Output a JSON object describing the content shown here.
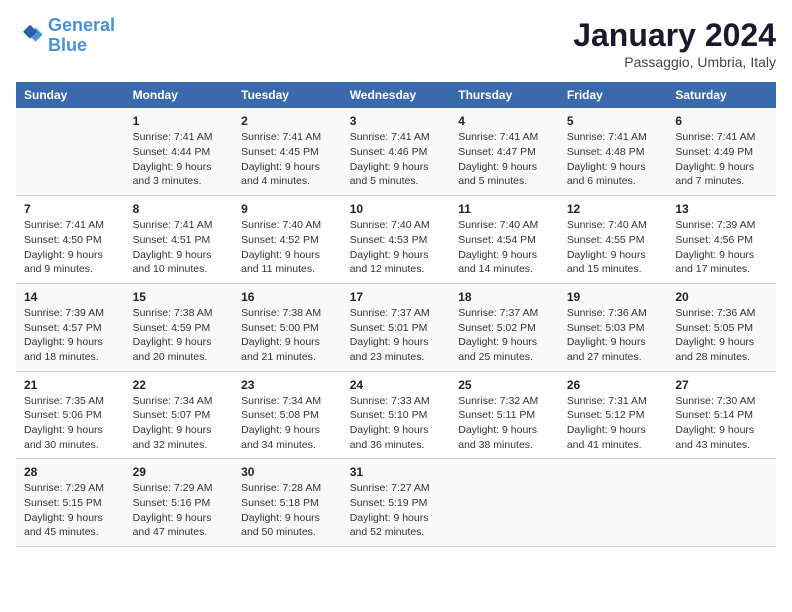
{
  "logo": {
    "line1": "General",
    "line2": "Blue"
  },
  "title": "January 2024",
  "subtitle": "Passaggio, Umbria, Italy",
  "columns": [
    "Sunday",
    "Monday",
    "Tuesday",
    "Wednesday",
    "Thursday",
    "Friday",
    "Saturday"
  ],
  "weeks": [
    [
      {
        "day": "",
        "info": ""
      },
      {
        "day": "1",
        "info": "Sunrise: 7:41 AM\nSunset: 4:44 PM\nDaylight: 9 hours\nand 3 minutes."
      },
      {
        "day": "2",
        "info": "Sunrise: 7:41 AM\nSunset: 4:45 PM\nDaylight: 9 hours\nand 4 minutes."
      },
      {
        "day": "3",
        "info": "Sunrise: 7:41 AM\nSunset: 4:46 PM\nDaylight: 9 hours\nand 5 minutes."
      },
      {
        "day": "4",
        "info": "Sunrise: 7:41 AM\nSunset: 4:47 PM\nDaylight: 9 hours\nand 5 minutes."
      },
      {
        "day": "5",
        "info": "Sunrise: 7:41 AM\nSunset: 4:48 PM\nDaylight: 9 hours\nand 6 minutes."
      },
      {
        "day": "6",
        "info": "Sunrise: 7:41 AM\nSunset: 4:49 PM\nDaylight: 9 hours\nand 7 minutes."
      }
    ],
    [
      {
        "day": "7",
        "info": "Sunrise: 7:41 AM\nSunset: 4:50 PM\nDaylight: 9 hours\nand 9 minutes."
      },
      {
        "day": "8",
        "info": "Sunrise: 7:41 AM\nSunset: 4:51 PM\nDaylight: 9 hours\nand 10 minutes."
      },
      {
        "day": "9",
        "info": "Sunrise: 7:40 AM\nSunset: 4:52 PM\nDaylight: 9 hours\nand 11 minutes."
      },
      {
        "day": "10",
        "info": "Sunrise: 7:40 AM\nSunset: 4:53 PM\nDaylight: 9 hours\nand 12 minutes."
      },
      {
        "day": "11",
        "info": "Sunrise: 7:40 AM\nSunset: 4:54 PM\nDaylight: 9 hours\nand 14 minutes."
      },
      {
        "day": "12",
        "info": "Sunrise: 7:40 AM\nSunset: 4:55 PM\nDaylight: 9 hours\nand 15 minutes."
      },
      {
        "day": "13",
        "info": "Sunrise: 7:39 AM\nSunset: 4:56 PM\nDaylight: 9 hours\nand 17 minutes."
      }
    ],
    [
      {
        "day": "14",
        "info": "Sunrise: 7:39 AM\nSunset: 4:57 PM\nDaylight: 9 hours\nand 18 minutes."
      },
      {
        "day": "15",
        "info": "Sunrise: 7:38 AM\nSunset: 4:59 PM\nDaylight: 9 hours\nand 20 minutes."
      },
      {
        "day": "16",
        "info": "Sunrise: 7:38 AM\nSunset: 5:00 PM\nDaylight: 9 hours\nand 21 minutes."
      },
      {
        "day": "17",
        "info": "Sunrise: 7:37 AM\nSunset: 5:01 PM\nDaylight: 9 hours\nand 23 minutes."
      },
      {
        "day": "18",
        "info": "Sunrise: 7:37 AM\nSunset: 5:02 PM\nDaylight: 9 hours\nand 25 minutes."
      },
      {
        "day": "19",
        "info": "Sunrise: 7:36 AM\nSunset: 5:03 PM\nDaylight: 9 hours\nand 27 minutes."
      },
      {
        "day": "20",
        "info": "Sunrise: 7:36 AM\nSunset: 5:05 PM\nDaylight: 9 hours\nand 28 minutes."
      }
    ],
    [
      {
        "day": "21",
        "info": "Sunrise: 7:35 AM\nSunset: 5:06 PM\nDaylight: 9 hours\nand 30 minutes."
      },
      {
        "day": "22",
        "info": "Sunrise: 7:34 AM\nSunset: 5:07 PM\nDaylight: 9 hours\nand 32 minutes."
      },
      {
        "day": "23",
        "info": "Sunrise: 7:34 AM\nSunset: 5:08 PM\nDaylight: 9 hours\nand 34 minutes."
      },
      {
        "day": "24",
        "info": "Sunrise: 7:33 AM\nSunset: 5:10 PM\nDaylight: 9 hours\nand 36 minutes."
      },
      {
        "day": "25",
        "info": "Sunrise: 7:32 AM\nSunset: 5:11 PM\nDaylight: 9 hours\nand 38 minutes."
      },
      {
        "day": "26",
        "info": "Sunrise: 7:31 AM\nSunset: 5:12 PM\nDaylight: 9 hours\nand 41 minutes."
      },
      {
        "day": "27",
        "info": "Sunrise: 7:30 AM\nSunset: 5:14 PM\nDaylight: 9 hours\nand 43 minutes."
      }
    ],
    [
      {
        "day": "28",
        "info": "Sunrise: 7:29 AM\nSunset: 5:15 PM\nDaylight: 9 hours\nand 45 minutes."
      },
      {
        "day": "29",
        "info": "Sunrise: 7:29 AM\nSunset: 5:16 PM\nDaylight: 9 hours\nand 47 minutes."
      },
      {
        "day": "30",
        "info": "Sunrise: 7:28 AM\nSunset: 5:18 PM\nDaylight: 9 hours\nand 50 minutes."
      },
      {
        "day": "31",
        "info": "Sunrise: 7:27 AM\nSunset: 5:19 PM\nDaylight: 9 hours\nand 52 minutes."
      },
      {
        "day": "",
        "info": ""
      },
      {
        "day": "",
        "info": ""
      },
      {
        "day": "",
        "info": ""
      }
    ]
  ]
}
